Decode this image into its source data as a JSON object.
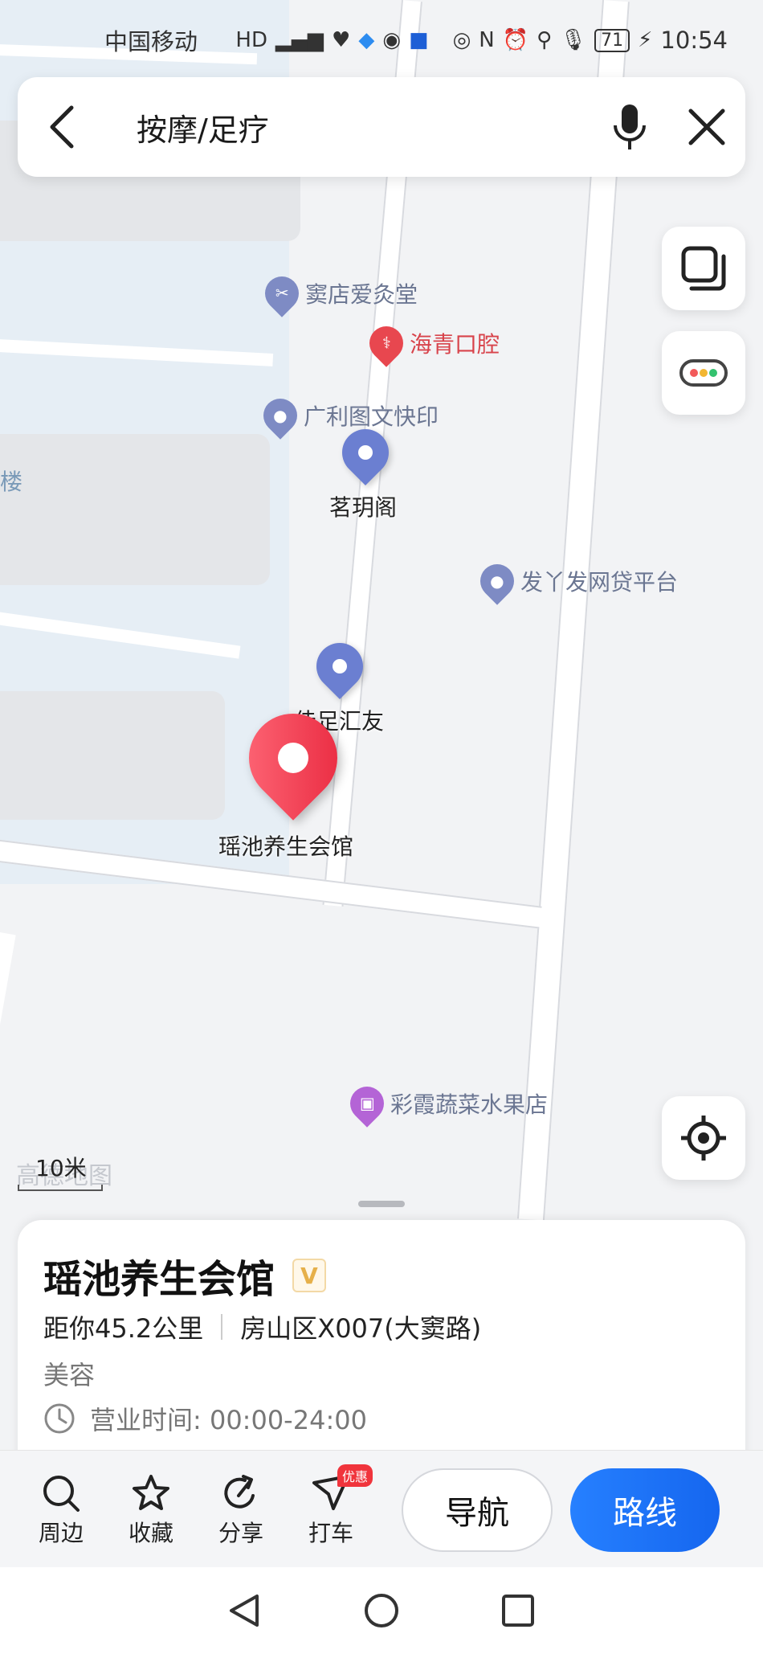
{
  "status_bar": {
    "carrier": "中国移动",
    "battery": "71",
    "time": "10:54"
  },
  "search": {
    "query": "按摩/足疗"
  },
  "map": {
    "pois": [
      {
        "name": "窦店爱灸堂",
        "icon": "scissors-icon",
        "color": "#7e8bc4"
      },
      {
        "name": "海青口腔",
        "icon": "tooth-icon",
        "color": "#e8474f"
      },
      {
        "name": "广利图文快印",
        "icon": "place-icon",
        "color": "#7e8bc4"
      },
      {
        "name": "发丫发网贷平台",
        "icon": "place-icon",
        "color": "#7e8bc4"
      },
      {
        "name": "彩霞蔬菜水果店",
        "icon": "basket-icon",
        "color": "#b464d6"
      }
    ],
    "edge_label": "楼",
    "result_pins": [
      {
        "name": "茗玥阁"
      },
      {
        "name": "佳足汇友"
      }
    ],
    "selected_pin": {
      "name": "瑶池养生会馆"
    },
    "scale": "10米",
    "watermark": "高德地图"
  },
  "place": {
    "name": "瑶池养生会馆",
    "badge": "V",
    "distance": "距你45.2公里",
    "address": "房山区X007(大窦路)",
    "category": "美容",
    "hours": "营业时间: 00:00-24:00"
  },
  "actions": {
    "nearby": "周边",
    "favorite": "收藏",
    "share": "分享",
    "taxi": "打车",
    "taxi_promo": "优惠",
    "navigate": "导航",
    "route": "路线"
  },
  "colors": {
    "accent": "#1a6ff2",
    "selected_pin": "#e8253c",
    "result_pin": "#6b7fd1"
  }
}
